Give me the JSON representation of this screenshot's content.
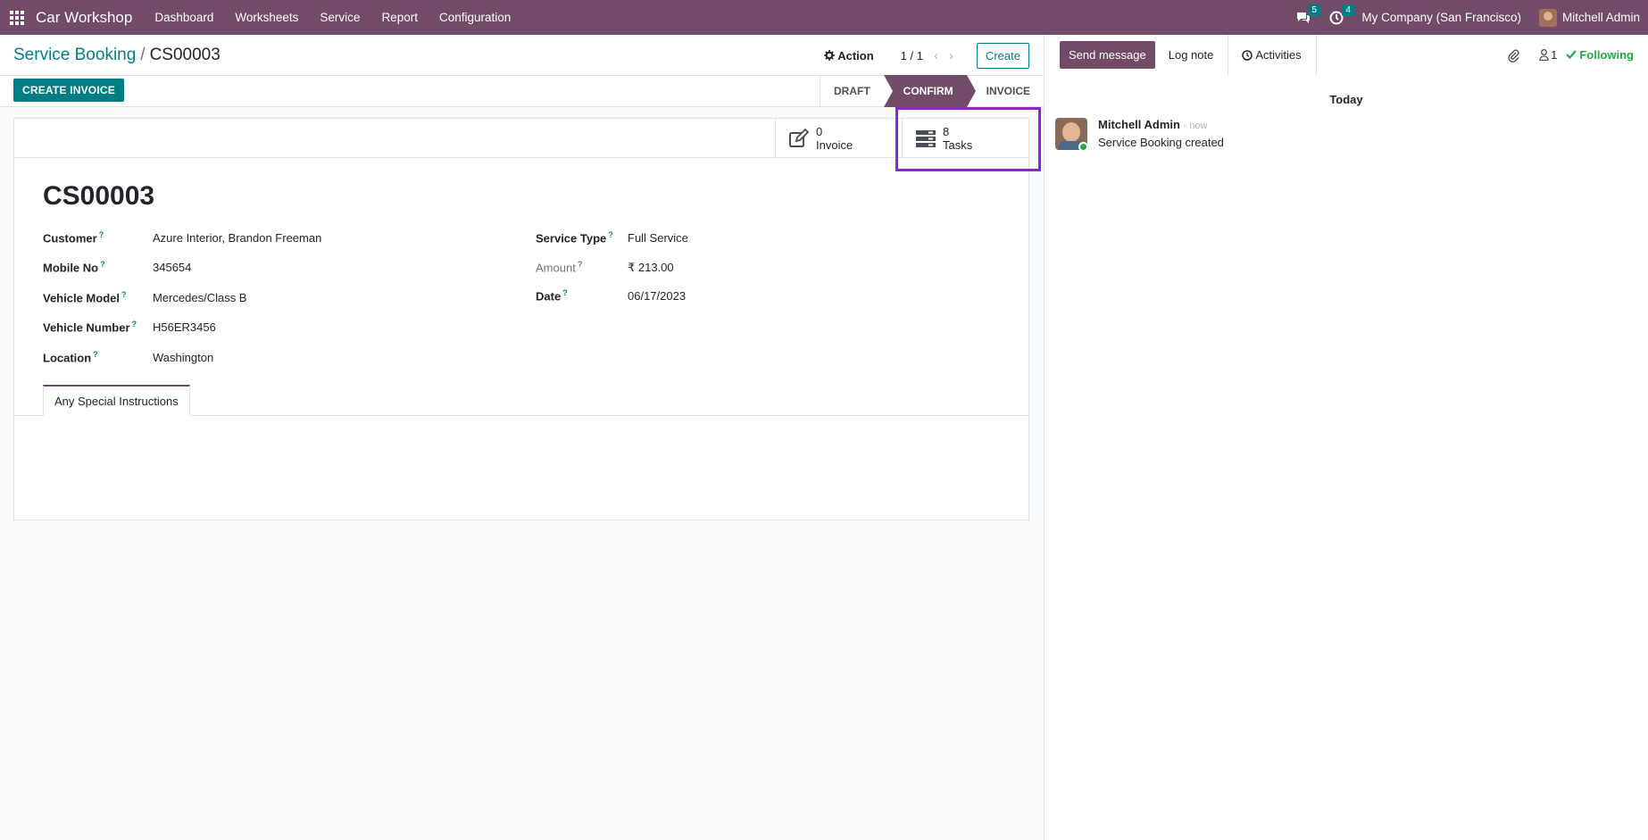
{
  "topbar": {
    "app_name": "Car Workshop",
    "menu": [
      "Dashboard",
      "Worksheets",
      "Service",
      "Report",
      "Configuration"
    ],
    "messages_count": "5",
    "activities_count": "4",
    "company": "My Company (San Francisco)",
    "user": "Mitchell Admin"
  },
  "control_panel": {
    "breadcrumb_parent": "Service Booking",
    "breadcrumb_separator": "/",
    "breadcrumb_current": "CS00003",
    "action_label": "Action",
    "pager": "1 / 1",
    "create_label": "Create",
    "create_invoice_label": "CREATE INVOICE",
    "statuses": [
      "DRAFT",
      "CONFIRM",
      "INVOICE"
    ],
    "active_status": "CONFIRM"
  },
  "smart_buttons": {
    "invoice": {
      "count": "0",
      "label": "Invoice"
    },
    "tasks": {
      "count": "8",
      "label": "Tasks"
    }
  },
  "form": {
    "title": "CS00003",
    "left_fields": [
      {
        "label": "Customer",
        "value": "Azure Interior, Brandon Freeman"
      },
      {
        "label": "Mobile No",
        "value": "345654"
      },
      {
        "label": "Vehicle Model",
        "value": "Mercedes/Class B"
      },
      {
        "label": "Vehicle Number",
        "value": "H56ER3456"
      },
      {
        "label": "Location",
        "value": "Washington"
      }
    ],
    "right_fields": [
      {
        "label": "Service Type",
        "value": "Full Service"
      },
      {
        "label": "Amount",
        "value": "₹ 213.00"
      },
      {
        "label": "Date",
        "value": "06/17/2023"
      }
    ],
    "help_marker": "?",
    "tab": "Any Special Instructions"
  },
  "chatter": {
    "send_message": "Send message",
    "log_note": "Log note",
    "activities": "Activities",
    "followers_count": "1",
    "following": "Following",
    "date_separator": "Today",
    "message": {
      "author": "Mitchell Admin",
      "time": "- now",
      "body": "Service Booking created"
    }
  },
  "colors": {
    "brand": "#714b67",
    "accent": "#017e84",
    "highlight": "#8e24cc",
    "following": "#28a745"
  }
}
